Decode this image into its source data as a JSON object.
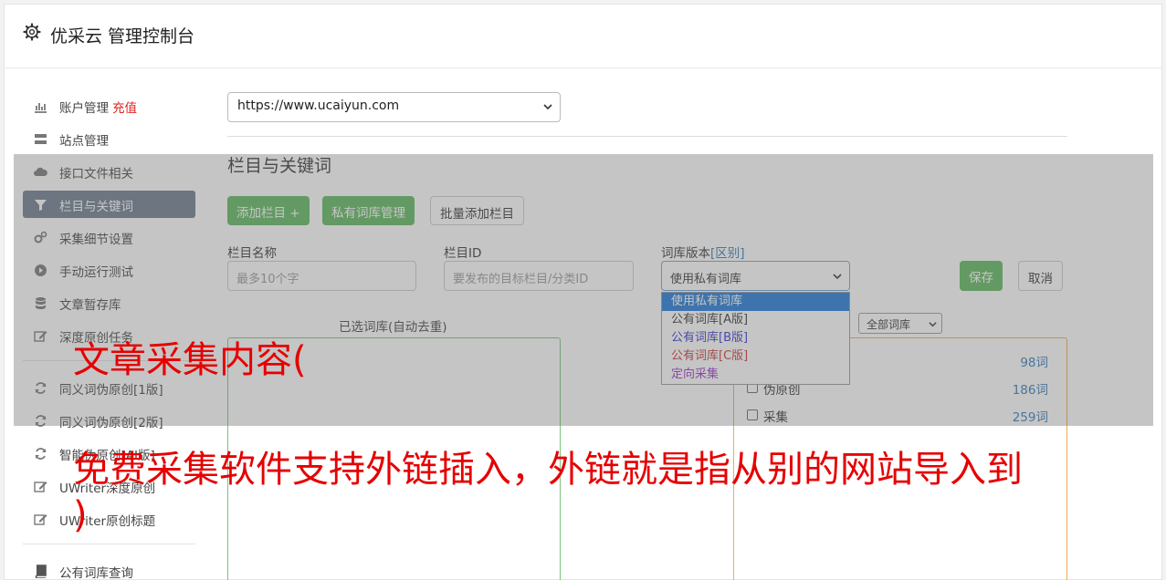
{
  "header": {
    "title": "优采云 管理控制台"
  },
  "sidebar": {
    "items": [
      {
        "label": "账户管理",
        "extra": "充值",
        "icon": "bar-chart-icon"
      },
      {
        "label": "站点管理",
        "icon": "server-icon"
      },
      {
        "label": "接口文件相关",
        "icon": "cloud-upload-icon"
      },
      {
        "label": "栏目与关键词",
        "icon": "filter-icon",
        "active": true
      },
      {
        "label": "采集细节设置",
        "icon": "cogs-icon"
      },
      {
        "label": "手动运行测试",
        "icon": "play-circle-icon"
      },
      {
        "label": "文章暂存库",
        "icon": "database-icon"
      },
      {
        "label": "深度原创任务",
        "icon": "edit-icon"
      },
      {
        "label": "同义词伪原创[1版]",
        "icon": "refresh-icon"
      },
      {
        "label": "同义词伪原创[2版]",
        "icon": "refresh-icon"
      },
      {
        "label": "智能伪原创[AI版]",
        "icon": "refresh-icon"
      },
      {
        "label": "UWriter深度原创",
        "icon": "edit-icon"
      },
      {
        "label": "UWriter原创标题",
        "icon": "edit-icon"
      },
      {
        "label": "公有词库查询",
        "icon": "book-icon"
      }
    ]
  },
  "main": {
    "site_select": "https://www.ucaiyun.com",
    "section_title": "栏目与关键词",
    "buttons": {
      "add_column": "添加栏目 +",
      "private_lib": "私有词库管理",
      "batch_add": "批量添加栏目"
    },
    "form": {
      "name_label": "栏目名称",
      "name_placeholder": "最多10个字",
      "id_label": "栏目ID",
      "id_placeholder": "要发布的目标栏目/分类ID",
      "version_label": "词库版本",
      "version_link": "[区别]",
      "version_value": "使用私有词库",
      "save": "保存",
      "cancel": "取消"
    },
    "dropdown_options": [
      {
        "label": "使用私有词库",
        "color": "#ffffff",
        "selected": true
      },
      {
        "label": "公有词库[A版]",
        "color": "#333333"
      },
      {
        "label": "公有词库[B版]",
        "color": "#3333cc"
      },
      {
        "label": "公有词库[C版]",
        "color": "#cc3333"
      },
      {
        "label": "定向采集",
        "color": "#9933cc"
      }
    ],
    "selected_label": "已选词库(自动去重)",
    "filter_select": "全部词库",
    "libraries": [
      {
        "name": "",
        "count": "98词"
      },
      {
        "name": "伪原创",
        "count": "186词"
      },
      {
        "name": "采集",
        "count": "259词"
      }
    ]
  },
  "overlay_text": {
    "line1": "文章采集内容(",
    "line2": "免费采集软件支持外链插入，外链就是指从别的网站导入到",
    "line3": ")"
  }
}
